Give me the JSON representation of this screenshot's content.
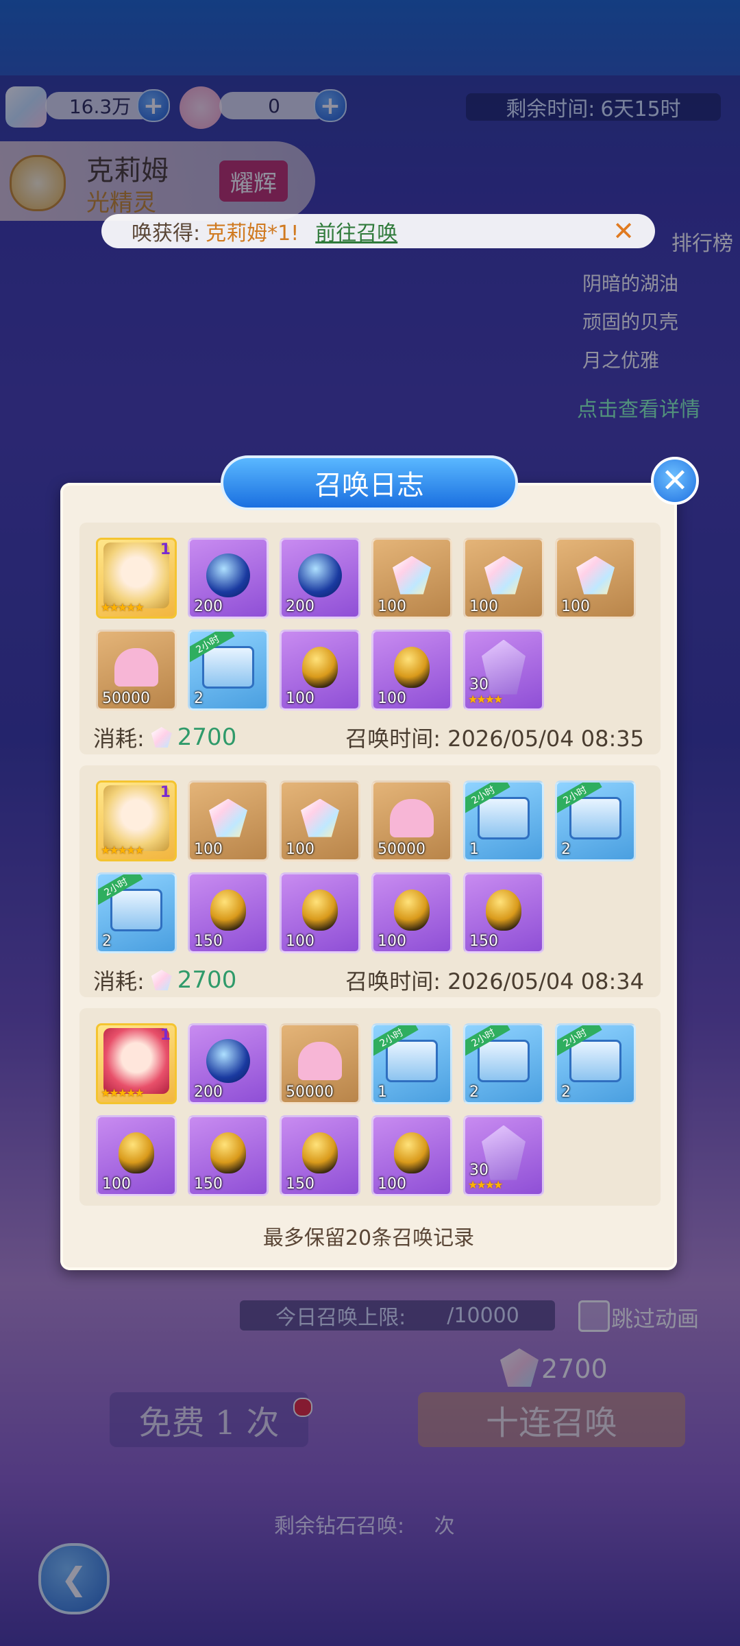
{
  "resources": {
    "crystals": "16.3万",
    "flowers": "0"
  },
  "timer": {
    "label": "剩余时间:",
    "value": "6天15时"
  },
  "character": {
    "name": "克莉姆",
    "class": "光精灵",
    "badge": "耀辉"
  },
  "notification": {
    "prefix": "唤获得:",
    "item": "克莉姆*1!",
    "link": "前往召唤"
  },
  "ranking": {
    "title": "排行榜",
    "items": [
      "阴暗的湖油",
      "顽固的贝壳",
      "月之优雅"
    ],
    "detail_link": "点击查看详情"
  },
  "modal": {
    "title": "召唤日志",
    "footer": "最多保留20条召唤记录"
  },
  "labels": {
    "cost": "消耗:",
    "time": "召唤时间:"
  },
  "records": [
    {
      "cost": "2700",
      "time": "2026/05/04 08:35",
      "row1": [
        {
          "kind": "char-blonde",
          "lvl": "1",
          "stars": "★★★★★"
        },
        {
          "kind": "orb",
          "qty": "200"
        },
        {
          "kind": "orb",
          "qty": "200"
        },
        {
          "kind": "gem",
          "qty": "100"
        },
        {
          "kind": "gem",
          "qty": "100"
        },
        {
          "kind": "gem",
          "qty": "100"
        }
      ],
      "row2": [
        {
          "kind": "heart",
          "qty": "50000"
        },
        {
          "kind": "chest",
          "qty": "2",
          "tag": "2小时"
        },
        {
          "kind": "egg",
          "qty": "100"
        },
        {
          "kind": "egg",
          "qty": "100"
        },
        {
          "kind": "crystal",
          "qty": "30",
          "stars": "★★★★"
        }
      ]
    },
    {
      "cost": "2700",
      "time": "2026/05/04 08:34",
      "row1": [
        {
          "kind": "char-blonde",
          "lvl": "1",
          "stars": "★★★★★"
        },
        {
          "kind": "gem",
          "qty": "100"
        },
        {
          "kind": "gem",
          "qty": "100"
        },
        {
          "kind": "heart",
          "qty": "50000"
        },
        {
          "kind": "chest",
          "qty": "1",
          "tag": "2小时"
        },
        {
          "kind": "chest",
          "qty": "2",
          "tag": "2小时"
        }
      ],
      "row2": [
        {
          "kind": "chest",
          "qty": "2",
          "tag": "2小时"
        },
        {
          "kind": "egg",
          "qty": "150"
        },
        {
          "kind": "egg",
          "qty": "100"
        },
        {
          "kind": "egg",
          "qty": "100"
        },
        {
          "kind": "egg",
          "qty": "150"
        }
      ]
    },
    {
      "cost": "",
      "time": "",
      "row1": [
        {
          "kind": "char-red",
          "lvl": "1",
          "stars": "★★★★★"
        },
        {
          "kind": "orb",
          "qty": "200"
        },
        {
          "kind": "heart",
          "qty": "50000"
        },
        {
          "kind": "chest",
          "qty": "1",
          "tag": "2小时"
        },
        {
          "kind": "chest",
          "qty": "2",
          "tag": "2小时"
        },
        {
          "kind": "chest",
          "qty": "2",
          "tag": "2小时"
        }
      ],
      "row2": [
        {
          "kind": "egg",
          "qty": "100"
        },
        {
          "kind": "egg",
          "qty": "150"
        },
        {
          "kind": "egg",
          "qty": "150"
        },
        {
          "kind": "egg",
          "qty": "100"
        },
        {
          "kind": "crystal",
          "qty": "30",
          "stars": "★★★★"
        }
      ]
    }
  ],
  "bottom": {
    "limit_label": "今日召唤上限:",
    "limit_value": "/10000",
    "skip": "跳过动画",
    "diamond_cost": "2700",
    "free": "免费 1 次",
    "ten": "十连召唤",
    "remaining": "剩余钻石召唤:",
    "remaining_unit": "次"
  }
}
